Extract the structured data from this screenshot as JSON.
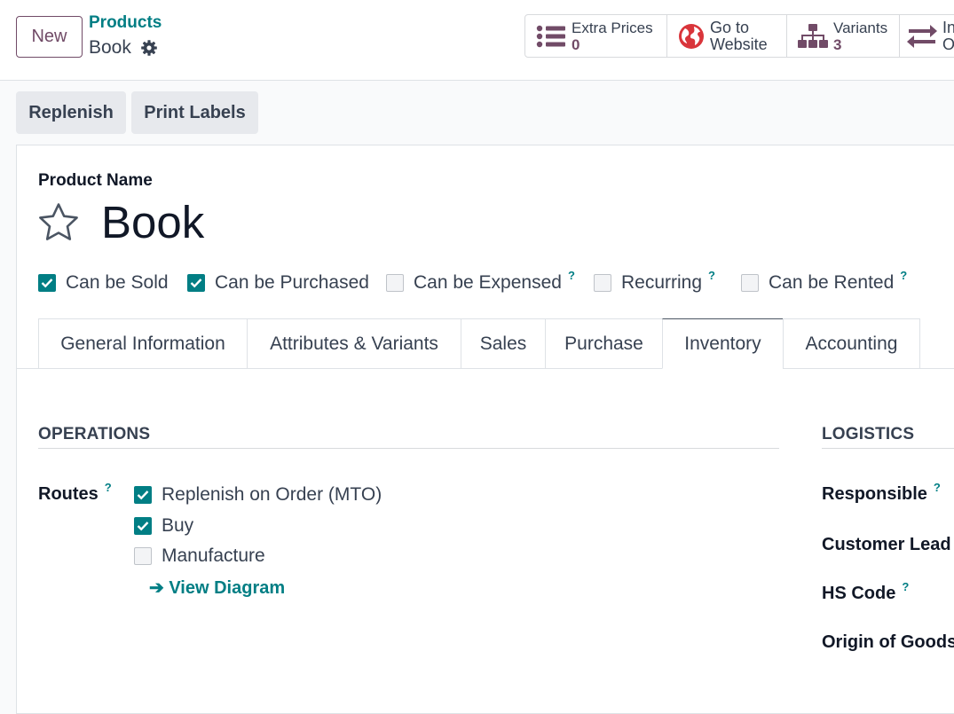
{
  "header": {
    "new_label": "New",
    "breadcrumb": "Products",
    "record_name": "Book"
  },
  "smart_buttons": {
    "extra_prices": {
      "label": "Extra Prices",
      "count": "0"
    },
    "website": {
      "line1": "Go to",
      "line2": "Website"
    },
    "variants": {
      "label": "Variants",
      "count": "3"
    },
    "partial": {
      "line1": "In",
      "line2": "O"
    }
  },
  "actions": {
    "replenish": "Replenish",
    "print_labels": "Print Labels"
  },
  "form": {
    "product_name_label": "Product Name",
    "product_name": "Book",
    "flags": [
      {
        "label": "Can be Sold",
        "checked": true
      },
      {
        "label": "Can be Purchased",
        "checked": true
      },
      {
        "label": "Can be Expensed",
        "checked": false,
        "help": "?"
      },
      {
        "label": "Recurring",
        "checked": false,
        "help": "?"
      },
      {
        "label": "Can be Rented",
        "checked": false,
        "help": "?"
      }
    ]
  },
  "tabs": [
    {
      "label": "General Information"
    },
    {
      "label": "Attributes & Variants"
    },
    {
      "label": "Sales"
    },
    {
      "label": "Purchase"
    },
    {
      "label": "Inventory",
      "active": true
    },
    {
      "label": "Accounting"
    }
  ],
  "operations": {
    "title": "OPERATIONS",
    "routes_label": "Routes",
    "help": "?",
    "routes": [
      {
        "label": "Replenish on Order (MTO)",
        "checked": true
      },
      {
        "label": "Buy",
        "checked": true
      },
      {
        "label": "Manufacture",
        "checked": false
      }
    ],
    "view_diagram": "View Diagram",
    "arrow": "➔"
  },
  "logistics": {
    "title": "LOGISTICS",
    "responsible": "Responsible",
    "customer_lead": "Customer Lead T",
    "hs_code": "HS Code",
    "origin": "Origin of Goods",
    "help": "?"
  },
  "colors": {
    "brand": "#714b67",
    "teal": "#017e84"
  }
}
